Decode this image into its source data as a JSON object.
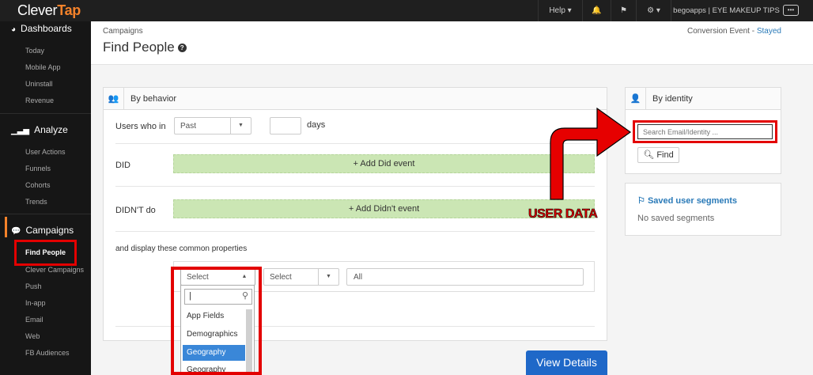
{
  "topbar": {
    "logo_main": "Clever",
    "logo_accent": "Tap",
    "help": "Help ▾",
    "bell_icon": "🔔",
    "bookmark_icon": "⚑",
    "settings_icon": "⚙ ▾",
    "account": "begoapps | EYE MAKEUP TIPS",
    "more_icon": "•••"
  },
  "sidebar": {
    "dashboards": "Dashboards",
    "dashboard_items": [
      "Today",
      "Mobile App",
      "Uninstall",
      "Revenue"
    ],
    "analyze": "Analyze",
    "analyze_items": [
      "User Actions",
      "Funnels",
      "Cohorts",
      "Trends"
    ],
    "campaigns": "Campaigns",
    "campaign_active": "Find People",
    "campaign_items": [
      "Clever Campaigns",
      "Push",
      "In-app",
      "Email",
      "Web",
      "FB Audiences"
    ]
  },
  "header": {
    "breadcrumb": "Campaigns",
    "title": "Find People",
    "help_icon": "?",
    "conversion_label": "Conversion Event",
    "conversion_sep": "-",
    "conversion_value": "Stayed"
  },
  "behavior": {
    "title": "By behavior",
    "users_who_in": "Users who in",
    "past_select": "Past",
    "days_value": "",
    "days_label": "days",
    "did_label": "DID",
    "add_did": "+ Add Did event",
    "didnt_label": "DIDN'T do",
    "add_didnt": "+ Add Didn't event",
    "common_props": "and display these common properties",
    "prop_select_1": "Select",
    "prop_select_2": "Select",
    "prop_all": "All"
  },
  "dropdown": {
    "search_value": "|",
    "options": [
      "App Fields",
      "Demographics",
      "Geography",
      "Geography"
    ],
    "highlighted_index": 2
  },
  "identity": {
    "title": "By identity",
    "search_placeholder": "Search Email/Identity ...",
    "find_label": "Find"
  },
  "segments": {
    "title": "Saved user segments",
    "empty": "No saved segments"
  },
  "buttons": {
    "view_details": "View Details"
  },
  "annotation": {
    "text": "USER DATA"
  }
}
